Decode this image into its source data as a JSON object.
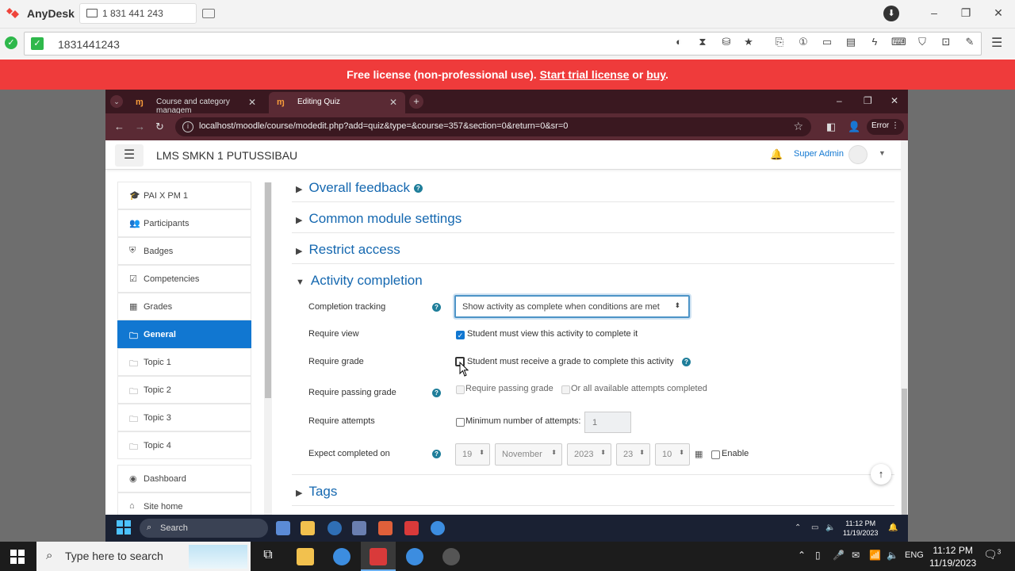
{
  "anydesk": {
    "app_title": "AnyDesk",
    "tab_label": "1 831 441 243",
    "address_value": "1831441243",
    "license_prefix": "Free license (non-professional use). ",
    "license_trial": "Start trial license",
    "license_or": " or ",
    "license_buy": "buy",
    "license_end": "."
  },
  "browser": {
    "tabs": [
      {
        "label": "Course and category managem"
      },
      {
        "label": "Editing Quiz"
      }
    ],
    "url": "localhost/moodle/course/modedit.php?add=quiz&type=&course=357&section=0&return=0&sr=0",
    "error_label": "Error"
  },
  "moodle": {
    "site_name": "LMS SMKN 1 PUTUSSIBAU",
    "user_name": "Super Admin",
    "sidebar": [
      {
        "label": "PAI X PM 1",
        "icon": "graduation-cap-icon",
        "glyph": "🎓"
      },
      {
        "label": "Participants",
        "icon": "users-icon",
        "glyph": "👥"
      },
      {
        "label": "Badges",
        "icon": "shield-icon",
        "glyph": "⛨"
      },
      {
        "label": "Competencies",
        "icon": "checkbox-icon",
        "glyph": "☑"
      },
      {
        "label": "Grades",
        "icon": "table-icon",
        "glyph": "▦"
      },
      {
        "label": "General",
        "icon": "folder-icon",
        "glyph": "🗀"
      },
      {
        "label": "Topic 1",
        "icon": "folder-icon",
        "glyph": "🗀"
      },
      {
        "label": "Topic 2",
        "icon": "folder-icon",
        "glyph": "🗀"
      },
      {
        "label": "Topic 3",
        "icon": "folder-icon",
        "glyph": "🗀"
      },
      {
        "label": "Topic 4",
        "icon": "folder-icon",
        "glyph": "🗀"
      },
      {
        "label": "Dashboard",
        "icon": "dashboard-icon",
        "glyph": "◉"
      },
      {
        "label": "Site home",
        "icon": "home-icon",
        "glyph": "⌂"
      }
    ],
    "active_sidebar": "General",
    "sections": {
      "overall_feedback": "Overall feedback",
      "common_module": "Common module settings",
      "restrict_access": "Restrict access",
      "activity_completion": "Activity completion",
      "tags": "Tags"
    },
    "form": {
      "completion_tracking_label": "Completion tracking",
      "completion_tracking_value": "Show activity as complete when conditions are met",
      "require_view_label": "Require view",
      "require_view_text": "Student must view this activity to complete it",
      "require_view_checked": true,
      "require_grade_label": "Require grade",
      "require_grade_text": "Student must receive a grade to complete this activity",
      "require_grade_checked": false,
      "require_passing_label": "Require passing grade",
      "require_passing_text": "Require passing grade",
      "all_attempts_text": "Or all available attempts completed",
      "require_attempts_label": "Require attempts",
      "min_attempts_text": "Minimum number of attempts:",
      "min_attempts_value": "1",
      "expect_completed_label": "Expect completed on",
      "date_day": "19",
      "date_month": "November",
      "date_year": "2023",
      "date_hour": "23",
      "date_minute": "10",
      "enable_text": "Enable"
    }
  },
  "remote_taskbar": {
    "search_label": "Search",
    "time": "11:12 PM",
    "date": "11/19/2023"
  },
  "host_taskbar": {
    "search_placeholder": "Type here to search",
    "lang": "ENG",
    "time": "11:12 PM",
    "date": "11/19/2023",
    "notif_count": "3"
  },
  "colors": {
    "license_bar": "#ef3b3b",
    "moodle_accent": "#1177d1",
    "browser_frame": "#5a2a34"
  }
}
